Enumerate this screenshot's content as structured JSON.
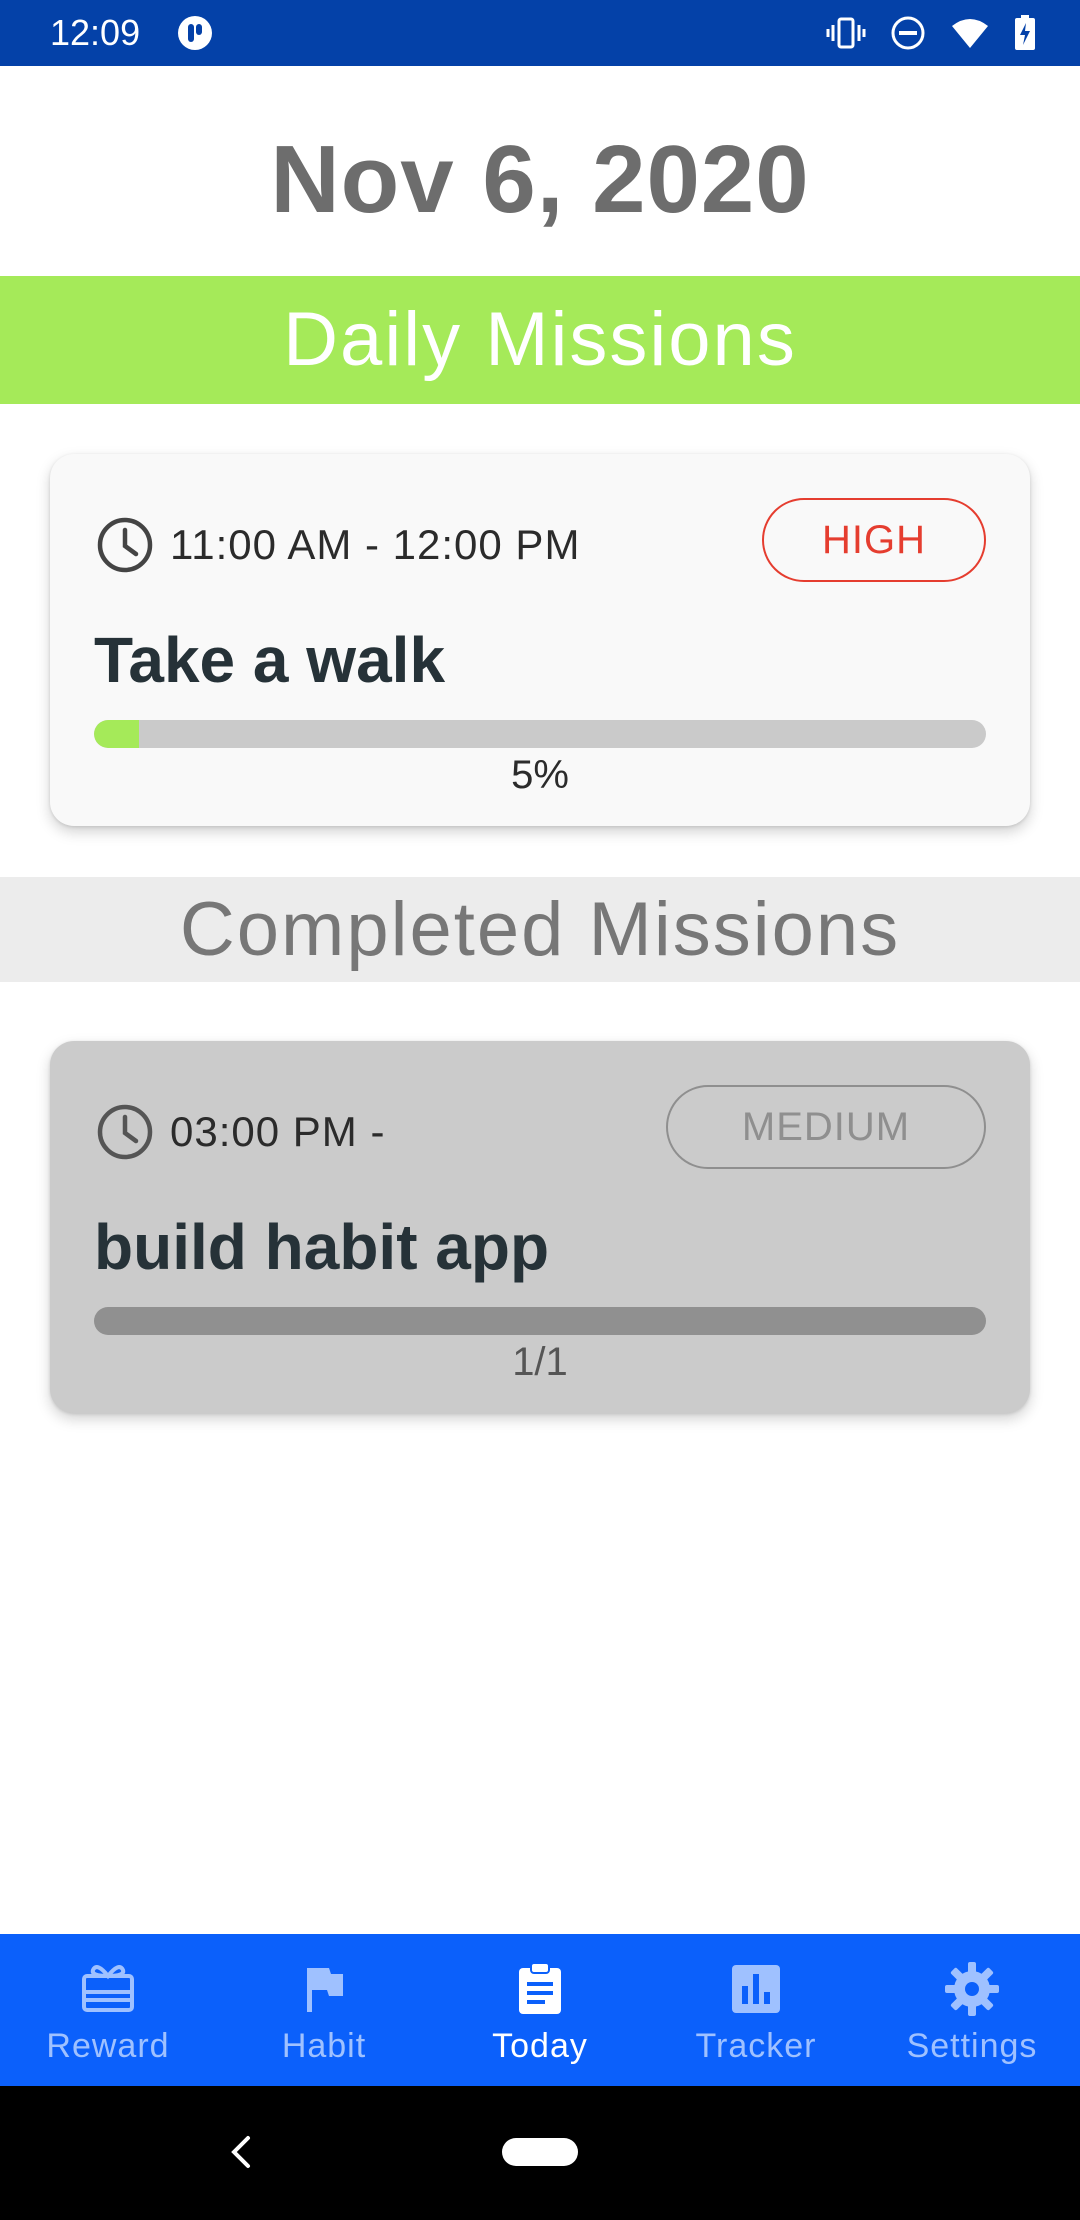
{
  "status_bar": {
    "time": "12:09",
    "icons": [
      "app-notification-icon",
      "vibrate-icon",
      "do-not-disturb-icon",
      "wifi-icon",
      "battery-charging-icon"
    ]
  },
  "date": "Nov 6, 2020",
  "sections": {
    "daily_title": "Daily Missions",
    "completed_title": "Completed Missions"
  },
  "daily_missions": [
    {
      "time": "11:00 AM - 12:00 PM",
      "priority": "HIGH",
      "title": "Take a walk",
      "progress_label": "5%",
      "progress_fraction": 0.05
    }
  ],
  "completed_missions": [
    {
      "time": "03:00 PM -",
      "priority": "MEDIUM",
      "title": "build habit app",
      "progress_label": "1/1",
      "progress_fraction": 1.0
    }
  ],
  "bottom_nav": {
    "items": [
      {
        "label": "Reward",
        "icon": "gift-card-icon",
        "active": false
      },
      {
        "label": "Habit",
        "icon": "flag-icon",
        "active": false
      },
      {
        "label": "Today",
        "icon": "clipboard-icon",
        "active": true
      },
      {
        "label": "Tracker",
        "icon": "bar-chart-icon",
        "active": false
      },
      {
        "label": "Settings",
        "icon": "gear-icon",
        "active": false
      }
    ]
  },
  "colors": {
    "status_bar": "#0441a8",
    "daily_banner": "#a5ea59",
    "completed_banner": "#ececec",
    "high_priority": "#e53d2f",
    "medium_priority": "#8f8f8f",
    "bottom_nav": "#0b60fb"
  }
}
